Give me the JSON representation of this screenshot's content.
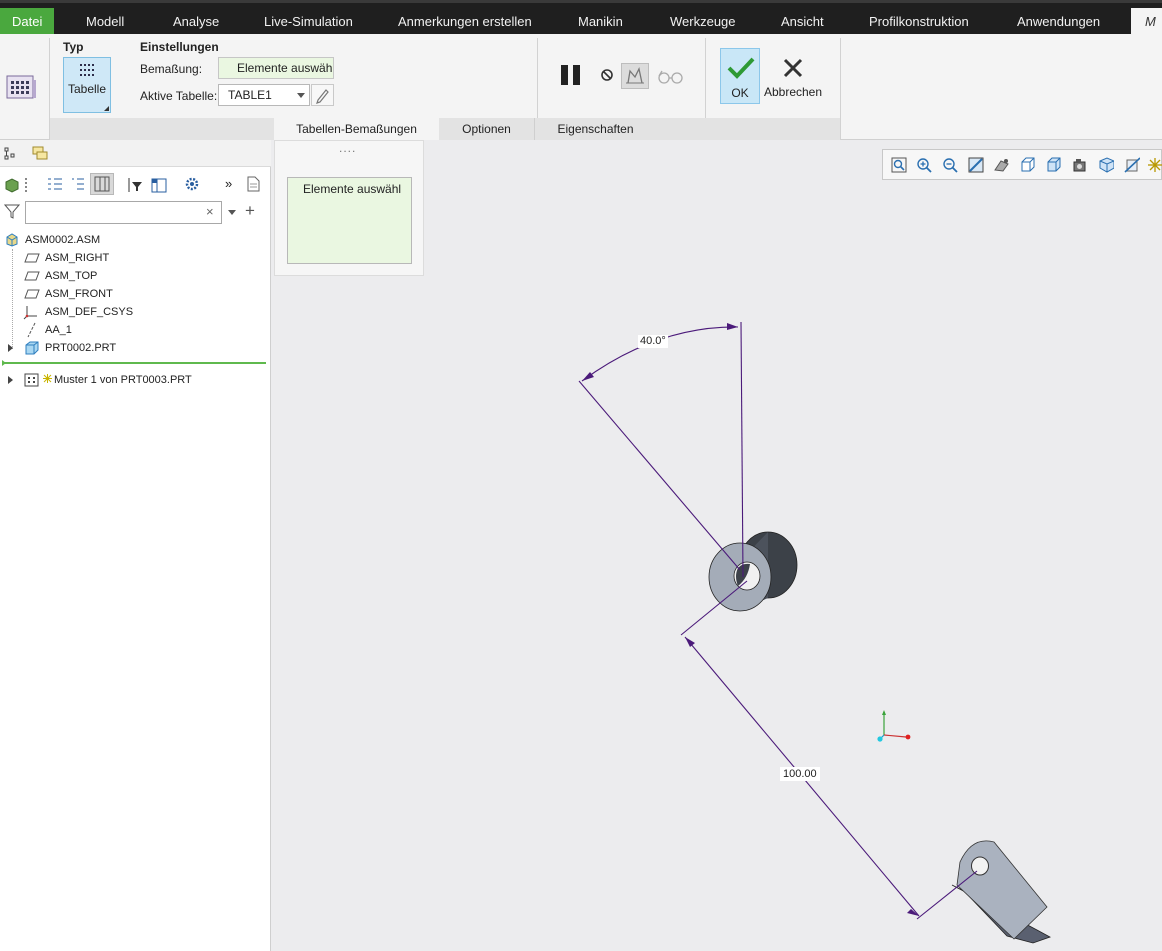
{
  "menu": {
    "tabs": [
      "Datei",
      "Modell",
      "Analyse",
      "Live-Simulation",
      "Anmerkungen erstellen",
      "Manikin",
      "Werkzeuge",
      "Ansicht",
      "Profilkonstruktion",
      "Anwendungen",
      "M"
    ]
  },
  "ribbon": {
    "type_group": {
      "title": "Typ",
      "table_button": "Tabelle"
    },
    "settings_group": {
      "title": "Einstellungen",
      "dimension_label": "Bemaßung:",
      "dimension_value": "Elemente auswähl",
      "active_table_label": "Aktive Tabelle:",
      "active_table_value": "TABLE1"
    },
    "ok_label": "OK",
    "cancel_label": "Abbrechen",
    "subtabs": [
      "Tabellen-Bemaßungen",
      "Optionen",
      "Eigenschaften"
    ]
  },
  "selection_panel": {
    "handle": "....",
    "field_text": "Elemente auswähl"
  },
  "tree": {
    "search_placeholder": "",
    "items": [
      {
        "label": "ASM0002.ASM",
        "icon": "assembly-icon"
      },
      {
        "label": "ASM_RIGHT",
        "icon": "datum-plane-icon"
      },
      {
        "label": "ASM_TOP",
        "icon": "datum-plane-icon"
      },
      {
        "label": "ASM_FRONT",
        "icon": "datum-plane-icon"
      },
      {
        "label": "ASM_DEF_CSYS",
        "icon": "csys-icon"
      },
      {
        "label": "AA_1",
        "icon": "axis-icon"
      },
      {
        "label": "PRT0002.PRT",
        "icon": "part-icon"
      },
      {
        "label": "Muster 1 von PRT0003.PRT",
        "icon": "pattern-icon"
      }
    ]
  },
  "graphics": {
    "angle_dimension": "40.0°",
    "linear_dimension": "100.00"
  },
  "colors": {
    "file_tab": "#4aa83e",
    "menubar": "#1f1f1f",
    "ok_button": "#c9e7f7",
    "dimension_line": "#4b1a7a",
    "selection_field": "#eaf7e1"
  }
}
